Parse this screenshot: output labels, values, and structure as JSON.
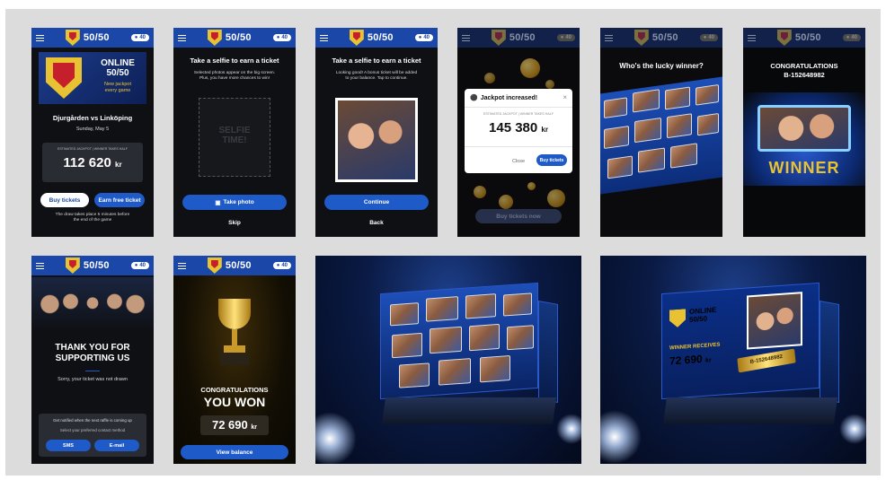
{
  "brand": {
    "name": "50/50",
    "ticket_count": "40"
  },
  "screen1": {
    "hero_title_line1": "ONLINE",
    "hero_title_line2": "50/50",
    "hero_sub_line1": "New jackpot",
    "hero_sub_line2": "every game",
    "match": "Djurgården vs Linköping",
    "date": "Sunday, May 5",
    "jackpot_label": "ESTIMATED JACKPOT | WINNER TAKES HALF",
    "jackpot_value": "112 620",
    "currency": "kr",
    "buy_label": "Buy tickets",
    "free_label": "Earn free ticket",
    "footer_line1": "The draw takes place 5 minutes before",
    "footer_line2": "the end of the game"
  },
  "screen2": {
    "title": "Take a selfie to earn a ticket",
    "desc_line1": "Selected photos appear on the big screen.",
    "desc_line2": "Plus, you have more chances to win!",
    "placeholder_line1": "SELFIE",
    "placeholder_line2": "TIME!",
    "take_photo_label": "Take photo",
    "skip_label": "Skip"
  },
  "screen3": {
    "title": "Take a selfie to earn a ticket",
    "desc_line1": "Looking good! A bonus ticket will be added",
    "desc_line2": "to your balance. Tap to continue.",
    "continue_label": "Continue",
    "back_label": "Back"
  },
  "screen4": {
    "dialog_title": "Jackpot increased!",
    "jackpot_label": "ESTIMATED JACKPOT | WINNER TAKES HALF",
    "jackpot_value": "145 380",
    "currency": "kr",
    "close_label": "Close",
    "buy_label": "Buy tickets",
    "bg_button_label": "Buy tickets now"
  },
  "screen5": {
    "title": "Who's the lucky winner?"
  },
  "screen6": {
    "title": "CONGRATULATIONS",
    "ticket_id": "B-152648982",
    "winner_label": "WINNER"
  },
  "screen7": {
    "title_line1": "THANK YOU FOR",
    "title_line2": "SUPPORTING US",
    "sorry": "Sorry, your ticket was not drawn",
    "notify_title": "Get notified when the next raffle is coming up",
    "notify_sub": "Select your preferred contact method",
    "sms_label": "SMS",
    "email_label": "E-mail"
  },
  "screen8": {
    "title_line1": "CONGRATULATIONS",
    "title_line2": "YOU WON",
    "amount": "72 690",
    "currency": "kr",
    "balance_label": "View balance"
  },
  "scene2": {
    "title_line1": "ONLINE",
    "title_line2": "50/50",
    "winner_receives": "WINNER RECEIVES",
    "amount": "72 690",
    "currency": "kr",
    "ticket_id": "B-152648982"
  },
  "colors": {
    "brand_blue": "#1a47a8",
    "button_blue": "#1f5ac9",
    "gold": "#e8c232",
    "crest_red": "#c41f2a"
  }
}
